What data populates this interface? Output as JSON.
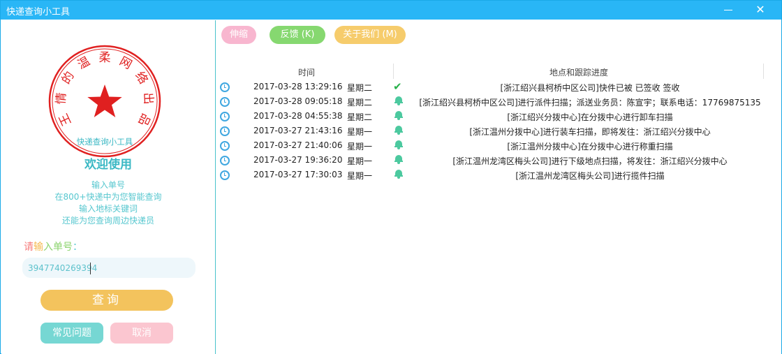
{
  "window": {
    "title": "快递查询小工具",
    "min_glyph": "—",
    "close_glyph": "✕"
  },
  "seal": {
    "ring_text": "王情的温柔网络出品",
    "chars": [
      "王",
      "情",
      "的",
      "温",
      "柔",
      "网",
      "络",
      "出",
      "品"
    ],
    "bottom_text": "快递查询小工具",
    "color": "#e02020"
  },
  "left": {
    "welcome": "欢迎使用",
    "intro_lines": [
      "输入单号",
      "在800+快递中为您智能查询",
      "输入地标关键词",
      "还能为您查询周边快递员"
    ],
    "prompt_chars": [
      "请",
      "输",
      "入",
      "单号",
      "："
    ],
    "tracking_value": "3947740269394",
    "query_label": "查询",
    "faq_label": "常见问题",
    "cancel_label": "取消"
  },
  "toolbar": {
    "collapse_label": "伸缩",
    "feedback_label": "反馈 (K)",
    "about_label": "关于我们 (M)"
  },
  "table": {
    "columns": [
      "时间",
      "地点和跟踪进度"
    ],
    "rows": [
      {
        "datetime": "2017-03-28 13:29:16",
        "weekday": "星期二",
        "status": "check-icon",
        "location": "[浙江绍兴县柯桥中区公司]快件已被 已签收 签收"
      },
      {
        "datetime": "2017-03-28 09:05:18",
        "weekday": "星期二",
        "status": "bell-icon",
        "location": "[浙江绍兴县柯桥中区公司]进行派件扫描；派送业务员：陈宣宇；联系电话：17769875135"
      },
      {
        "datetime": "2017-03-28 04:55:38",
        "weekday": "星期二",
        "status": "bell-icon",
        "location": "[浙江绍兴分拨中心]在分拨中心进行卸车扫描"
      },
      {
        "datetime": "2017-03-27 21:43:16",
        "weekday": "星期一",
        "status": "bell-icon",
        "location": "[浙江温州分拨中心]进行装车扫描，即将发往：浙江绍兴分拨中心"
      },
      {
        "datetime": "2017-03-27 21:40:06",
        "weekday": "星期一",
        "status": "bell-icon",
        "location": "[浙江温州分拨中心]在分拨中心进行称重扫描"
      },
      {
        "datetime": "2017-03-27 19:36:20",
        "weekday": "星期一",
        "status": "bell-icon",
        "location": "[浙江温州龙湾区梅头公司]进行下级地点扫描，将发往：浙江绍兴分拨中心"
      },
      {
        "datetime": "2017-03-27 17:30:03",
        "weekday": "星期一",
        "status": "bell-icon",
        "location": "[浙江温州龙湾区梅头公司]进行揽件扫描"
      }
    ]
  },
  "colors": {
    "titlebar": "#29b6f6",
    "accent": "#3bb8c4",
    "query_button": "#f3c35d",
    "faq_button": "#76d7d3",
    "cancel_button": "#fbc6d0",
    "check": "#27b04a",
    "bell": "#4cc99f"
  }
}
